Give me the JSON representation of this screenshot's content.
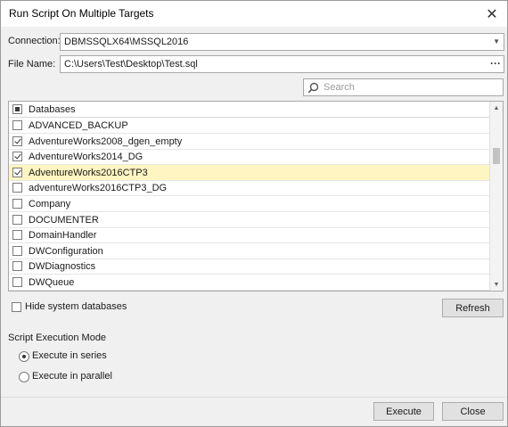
{
  "window": {
    "title": "Run Script On Multiple Targets",
    "close_glyph": "✕"
  },
  "connection": {
    "label": "Connection:",
    "value": "DBMSSQLX64\\MSSQL2016",
    "arrow_glyph": "▼"
  },
  "file": {
    "label": "File Name:",
    "value": "C:\\Users\\Test\\Desktop\\Test.sql",
    "browse_glyph": "···"
  },
  "search": {
    "placeholder": "Search"
  },
  "databases": {
    "header": "Databases",
    "items": [
      {
        "name": "ADVANCED_BACKUP",
        "checked": false,
        "selected": false
      },
      {
        "name": "AdventureWorks2008_dgen_empty",
        "checked": true,
        "selected": false
      },
      {
        "name": "AdventureWorks2014_DG",
        "checked": true,
        "selected": false
      },
      {
        "name": "AdventureWorks2016CTP3",
        "checked": true,
        "selected": true
      },
      {
        "name": "adventureWorks2016CTP3_DG",
        "checked": false,
        "selected": false
      },
      {
        "name": "Company",
        "checked": false,
        "selected": false
      },
      {
        "name": "DOCUMENTER",
        "checked": false,
        "selected": false
      },
      {
        "name": "DomainHandler",
        "checked": false,
        "selected": false
      },
      {
        "name": "DWConfiguration",
        "checked": false,
        "selected": false
      },
      {
        "name": "DWDiagnostics",
        "checked": false,
        "selected": false
      },
      {
        "name": "DWQueue",
        "checked": false,
        "selected": false
      }
    ],
    "scroll_up_glyph": "▲",
    "scroll_down_glyph": "▼"
  },
  "options": {
    "hide_system_label": "Hide system databases",
    "hide_system_checked": false,
    "refresh_label": "Refresh"
  },
  "execution_mode": {
    "label": "Script Execution Mode",
    "series_label": "Execute in series",
    "parallel_label": "Execute in parallel",
    "selected": "series"
  },
  "footer": {
    "execute_label": "Execute",
    "close_label": "Close"
  }
}
